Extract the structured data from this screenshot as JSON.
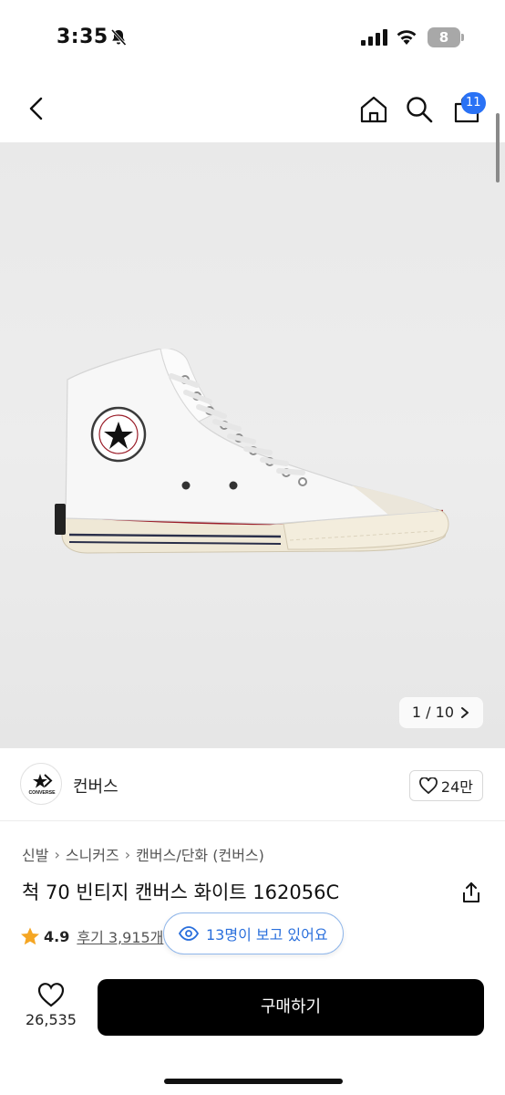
{
  "status_bar": {
    "time": "3:35",
    "battery_level": "8"
  },
  "nav": {
    "cart_count": "11"
  },
  "gallery": {
    "page_indicator": "1 / 10"
  },
  "brand": {
    "name": "컨버스",
    "logo_text": "CONVERSE",
    "like_count": "24만"
  },
  "breadcrumb": [
    "신발",
    "스니커즈",
    "캔버스/단화 (컨버스)"
  ],
  "product": {
    "title": "척 70 빈티지 캔버스 화이트 162056C",
    "rating": "4.9",
    "reviews": "후기 3,915개",
    "viewers": "13명이 보고 있어요"
  },
  "bottom_bar": {
    "wish_count": "26,535",
    "buy_label": "구매하기"
  },
  "colors": {
    "accent_blue": "#2a72f5",
    "star": "#f5a623",
    "buy_button": "#000000"
  }
}
